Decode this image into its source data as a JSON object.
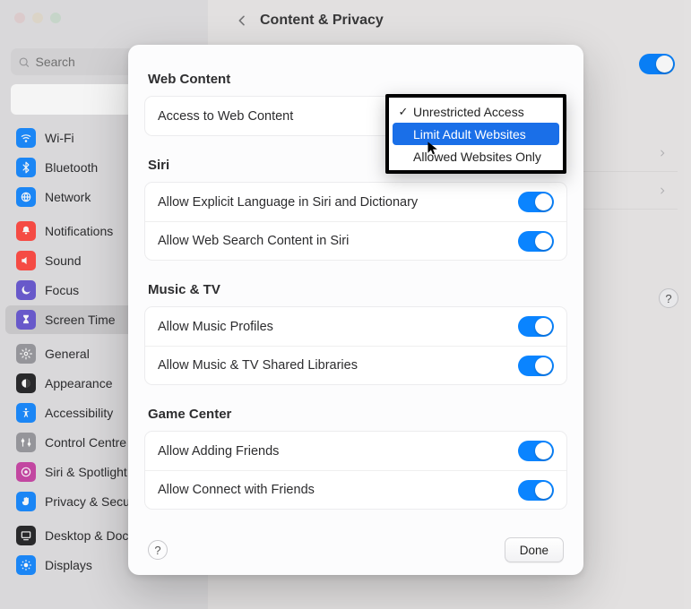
{
  "header": {
    "title": "Content & Privacy"
  },
  "search": {
    "placeholder": "Search"
  },
  "sidebar": {
    "groups": [
      [
        {
          "label": "Wi-Fi",
          "color": "#1d8cff",
          "icon": "wifi"
        },
        {
          "label": "Bluetooth",
          "color": "#1d8cff",
          "icon": "bluetooth"
        },
        {
          "label": "Network",
          "color": "#1d8cff",
          "icon": "network"
        }
      ],
      [
        {
          "label": "Notifications",
          "color": "#ff4f47",
          "icon": "bell"
        },
        {
          "label": "Sound",
          "color": "#ff4f47",
          "icon": "sound"
        },
        {
          "label": "Focus",
          "color": "#6d5dd3",
          "icon": "moon"
        },
        {
          "label": "Screen Time",
          "color": "#6d5dd3",
          "icon": "hourglass",
          "selected": true
        }
      ],
      [
        {
          "label": "General",
          "color": "#9c9ca1",
          "icon": "gear"
        },
        {
          "label": "Appearance",
          "color": "#2b2b2d",
          "icon": "appearance"
        },
        {
          "label": "Accessibility",
          "color": "#1d8cff",
          "icon": "accessibility"
        },
        {
          "label": "Control Centre",
          "color": "#9c9ca1",
          "icon": "control"
        },
        {
          "label": "Siri & Spotlight",
          "color": "#ca4aa8",
          "icon": "siri"
        },
        {
          "label": "Privacy & Security",
          "color": "#1d8cff",
          "icon": "hand"
        }
      ],
      [
        {
          "label": "Desktop & Dock",
          "color": "#2b2b2d",
          "icon": "desktop"
        },
        {
          "label": "Displays",
          "color": "#1d8cff",
          "icon": "displays"
        }
      ]
    ]
  },
  "background": {
    "content_privacy_toggle": true
  },
  "modal": {
    "sections": [
      {
        "title": "Web Content",
        "rows": [
          {
            "label": "Access to Web Content",
            "control": "menu"
          }
        ]
      },
      {
        "title": "Siri",
        "rows": [
          {
            "label": "Allow Explicit Language in Siri and Dictionary",
            "control": "toggle",
            "value": true
          },
          {
            "label": "Allow Web Search Content in Siri",
            "control": "toggle",
            "value": true
          }
        ]
      },
      {
        "title": "Music & TV",
        "rows": [
          {
            "label": "Allow Music Profiles",
            "control": "toggle",
            "value": true
          },
          {
            "label": "Allow Music & TV Shared Libraries",
            "control": "toggle",
            "value": true
          }
        ]
      },
      {
        "title": "Game Center",
        "rows": [
          {
            "label": "Allow Adding Friends",
            "control": "toggle",
            "value": true
          },
          {
            "label": "Allow Connect with Friends",
            "control": "toggle",
            "value": true
          }
        ]
      }
    ],
    "done_label": "Done"
  },
  "menu": {
    "items": [
      {
        "label": "Unrestricted Access",
        "checked": true,
        "highlighted": false
      },
      {
        "label": "Limit Adult Websites",
        "checked": false,
        "highlighted": true
      },
      {
        "label": "Allowed Websites Only",
        "checked": false,
        "highlighted": false
      }
    ]
  },
  "help_glyph": "?"
}
